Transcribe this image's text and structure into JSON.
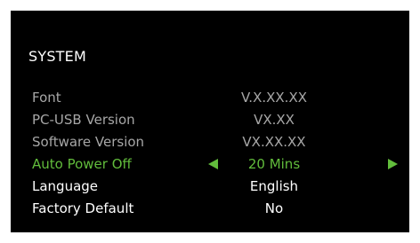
{
  "menu": {
    "title": "SYSTEM",
    "items": [
      {
        "label": "Font",
        "value": "V.X.XX.XX"
      },
      {
        "label": "PC-USB Version",
        "value": "VX.XX"
      },
      {
        "label": "Software Version",
        "value": "VX.XX.XX"
      },
      {
        "label": "Auto Power Off",
        "value": "20 Mins"
      },
      {
        "label": "Language",
        "value": "English"
      },
      {
        "label": "Factory Default",
        "value": "No"
      }
    ],
    "selected_index": 3
  },
  "colors": {
    "background": "#000000",
    "text_primary": "#ffffff",
    "text_dim": "#a7a7a7",
    "accent": "#62bd3c"
  },
  "icons": {
    "left": "left-triangle-arrow-icon",
    "right": "right-triangle-arrow-icon"
  }
}
